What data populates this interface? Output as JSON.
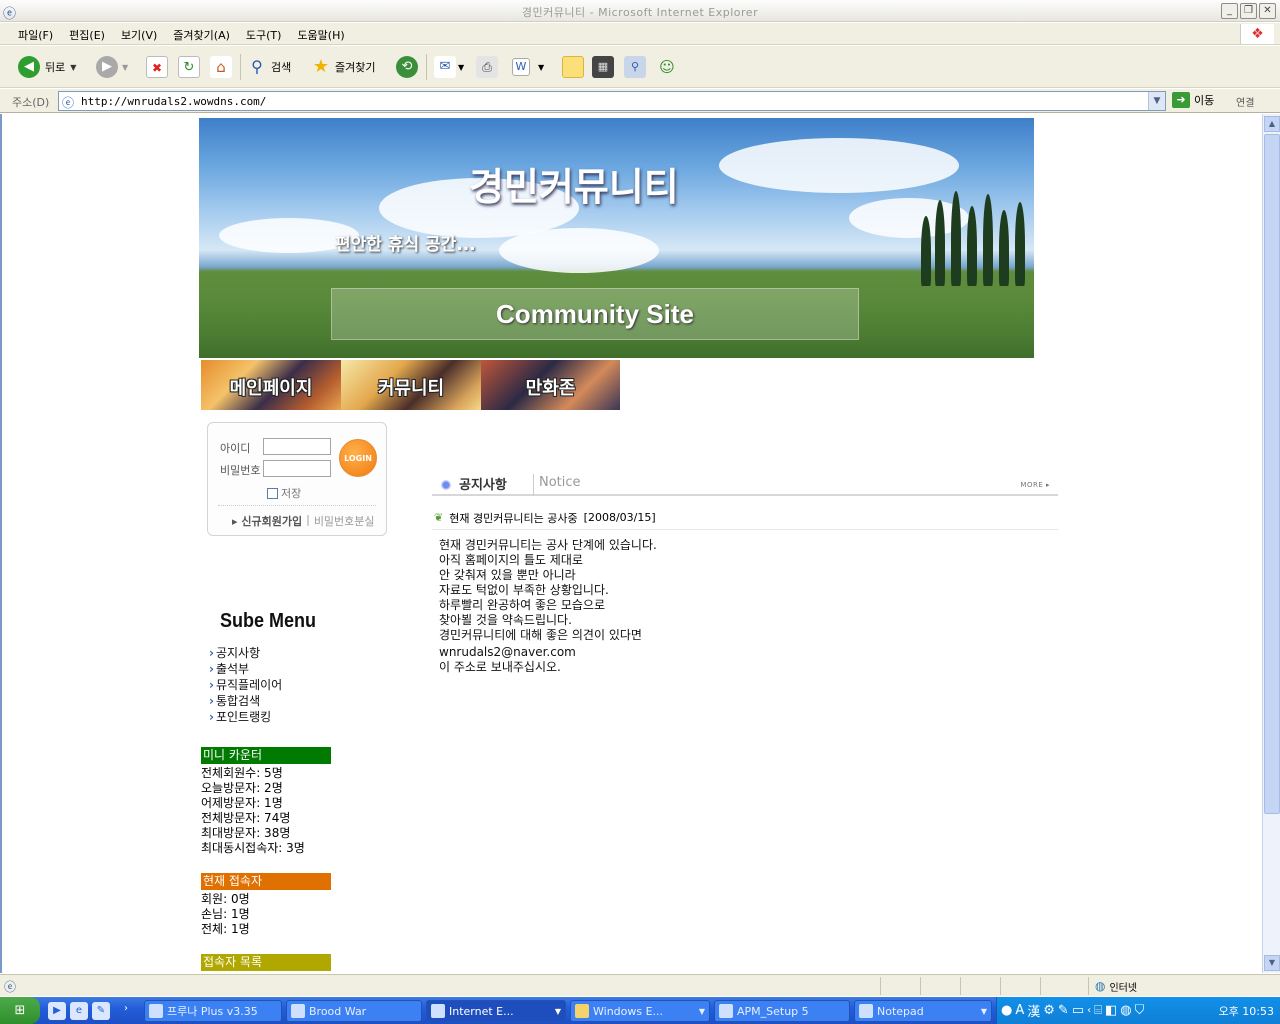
{
  "window": {
    "title": "경민커뮤니티 - Microsoft Internet Explorer"
  },
  "menu": [
    "파일(F)",
    "편집(E)",
    "보기(V)",
    "즐겨찾기(A)",
    "도구(T)",
    "도움말(H)"
  ],
  "toolbar": {
    "back_label": "뒤로",
    "search_label": "검색",
    "favorites_label": "즐겨찾기"
  },
  "address": {
    "label": "주소(D)",
    "url": "http://wnrudals2.wowdns.com/",
    "go_label": "이동",
    "links_label": "연결"
  },
  "banner": {
    "title": "경민커뮤니티",
    "subtitle": "편안한 휴식 공간...",
    "tagline": "Community Site"
  },
  "nav": [
    "메인페이지",
    "커뮤니티",
    "만화존"
  ],
  "login": {
    "id_label": "아이디",
    "pw_label": "비밀번호",
    "button": "LOGIN",
    "save_label": "저장",
    "signup": "신규회원가입",
    "separator": "|",
    "find_pw": "비밀번호분실"
  },
  "submenu": {
    "title": "Sube Menu",
    "items": [
      "공지사항",
      "출석부",
      "뮤직플레이어",
      "통합검색",
      "포인트랭킹"
    ]
  },
  "mini_counter": {
    "title": "미니 카운터",
    "lines": [
      "전체회원수: 5명",
      "오늘방문자: 2명",
      "어제방문자: 1명",
      "전체방문자: 74명",
      "최대방문자: 38명",
      "최대동시접속자: 3명"
    ],
    "color": "#007a00"
  },
  "current_users": {
    "title": "현재 접속자",
    "lines": [
      "회원: 0명",
      "손님: 1명",
      "전체: 1명"
    ],
    "color": "#e07000"
  },
  "user_list": {
    "title": "접속자 목록",
    "color": "#b0a800"
  },
  "notice": {
    "title_ko": "공지사항",
    "title_en": "Notice",
    "more": "MORE ▸",
    "subject": "현재 경민커뮤니티는 공사중",
    "date": "[2008/03/15]",
    "lines": [
      "현재 경민커뮤니티는 공사 단계에 있습니다.",
      "아직 홈페이지의 틀도 제대로",
      "안 갖춰져 있을 뿐만 아니라",
      "자료도 턱없이 부족한 상황입니다.",
      "하루빨리 완공하여 좋은 모습으로",
      "찾아뵐 것을 약속드립니다.",
      "경민커뮤니티에 대해 좋은 의견이 있다면"
    ],
    "email": "wnrudals2@naver.com",
    "last_line": "이 주소로 보내주십시오."
  },
  "status": {
    "zone": "인터넷"
  },
  "taskbar": {
    "tasks": [
      "프루나 Plus v3.35",
      "Brood War",
      "Internet E...",
      "Windows E...",
      "APM_Setup 5",
      "Notepad"
    ],
    "clock": "오후 10:53"
  }
}
